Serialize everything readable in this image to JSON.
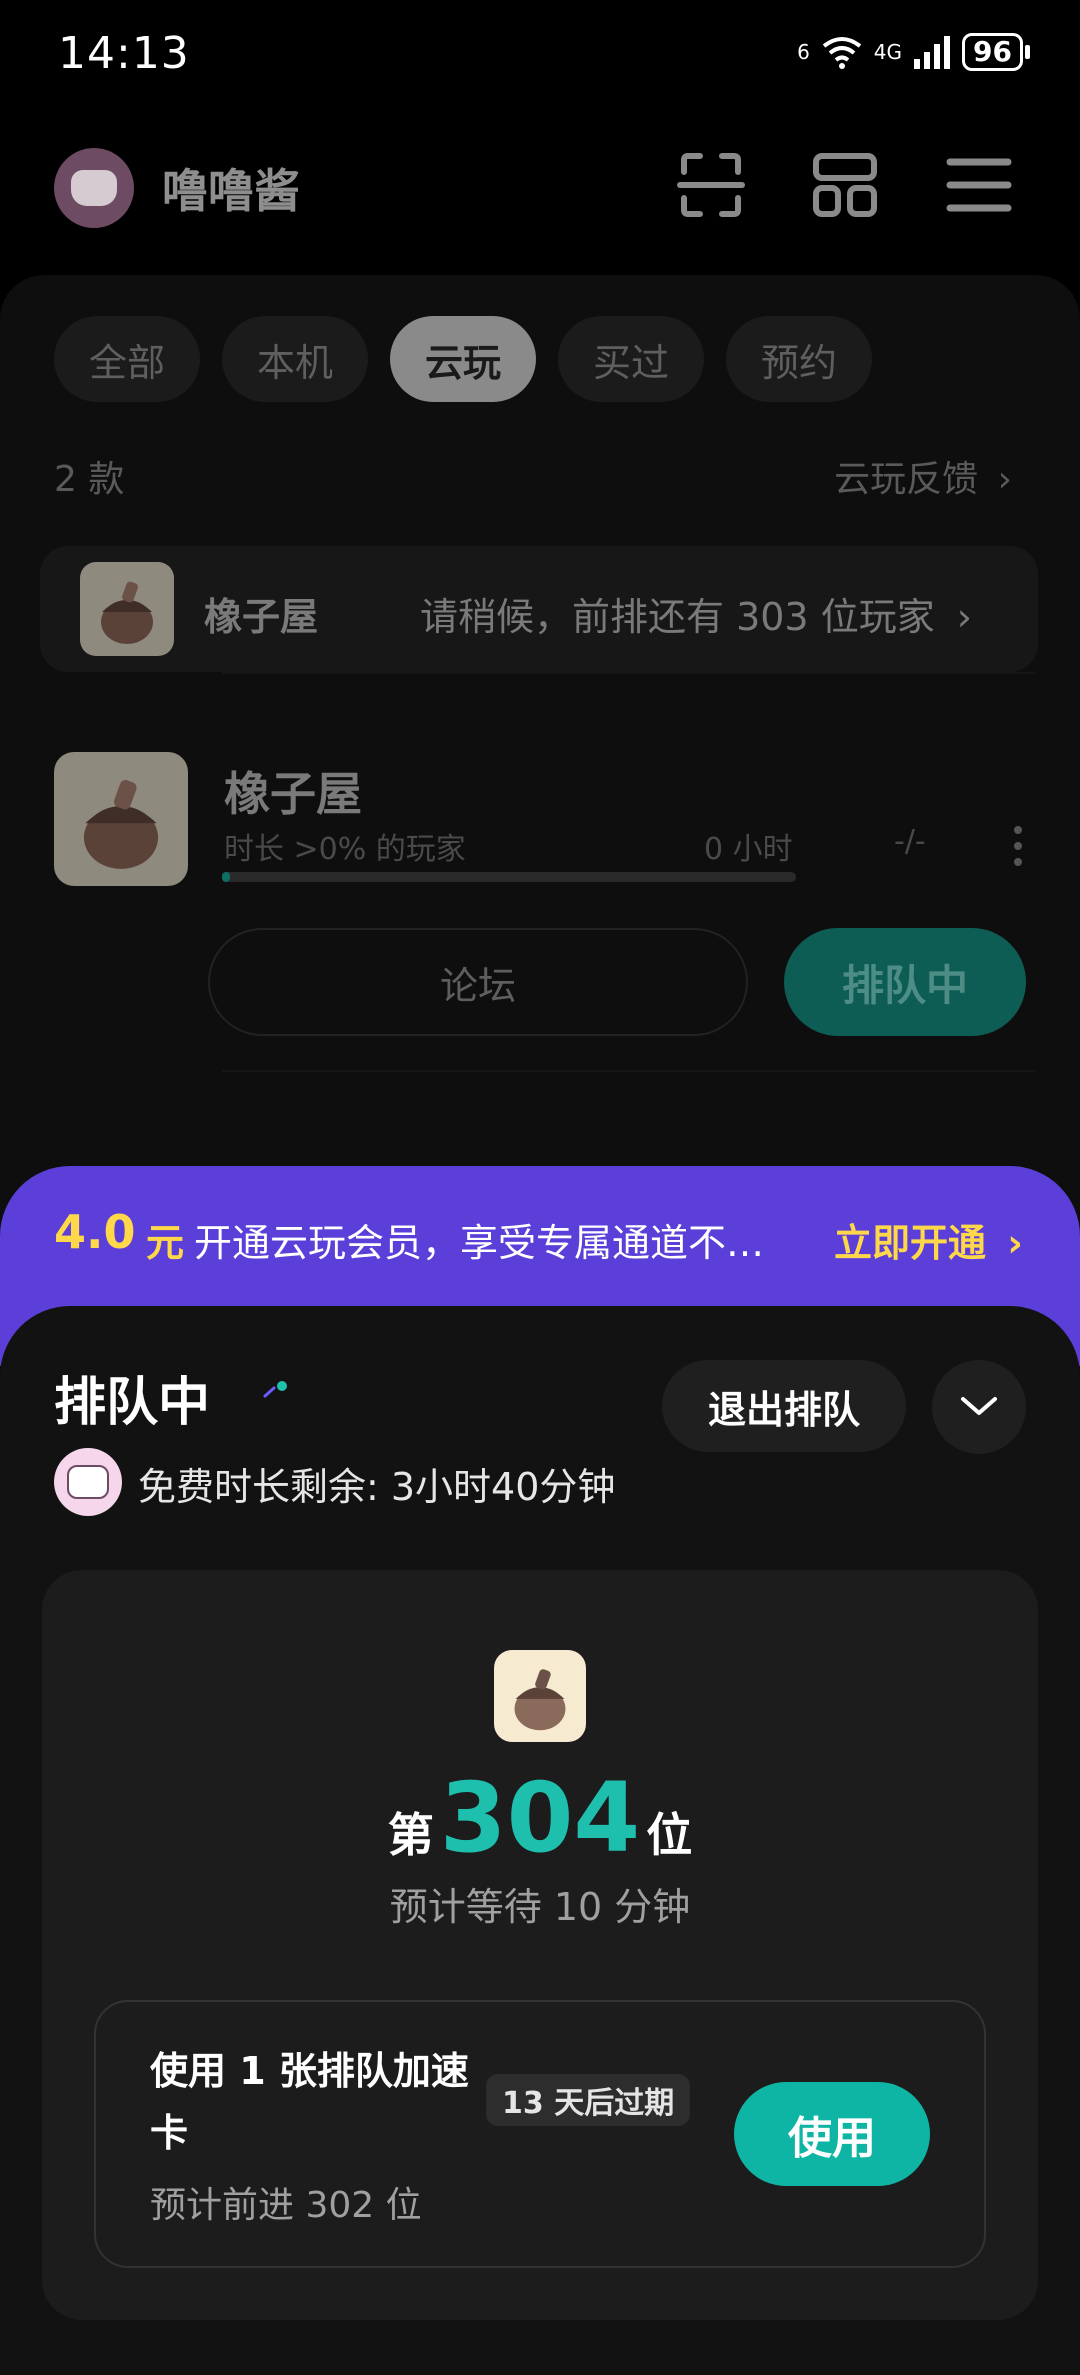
{
  "status_bar": {
    "time": "14:13",
    "signal_sim1": "6",
    "network_type": "4G",
    "battery": "96"
  },
  "header": {
    "username": "噜噜酱",
    "icons": [
      "scan-icon",
      "layout-grid-icon",
      "menu-icon"
    ]
  },
  "tabs": [
    {
      "label": "全部",
      "active": false
    },
    {
      "label": "本机",
      "active": false
    },
    {
      "label": "云玩",
      "active": true
    },
    {
      "label": "买过",
      "active": false
    },
    {
      "label": "预约",
      "active": false
    }
  ],
  "list_meta": {
    "count": "2 款",
    "feedback": "云玩反馈"
  },
  "queue_strip": {
    "game_name": "橡子屋",
    "message": "请稍候，前排还有 303 位玩家"
  },
  "game_card": {
    "name": "橡子屋",
    "subtitle": "时长 >0% 的玩家",
    "hours": "0 小时",
    "rating": "-/-",
    "progress": 0.01,
    "forum_label": "论坛",
    "queue_label": "排队中"
  },
  "promo": {
    "price": "4.0",
    "unit": "元",
    "text": "开通云玩会员，享受专属通道不…",
    "cta": "立即开通"
  },
  "queue_sheet": {
    "title": "排队中",
    "exit_label": "退出排队",
    "free_time": "免费时长剩余: 3小时40分钟",
    "rank_prefix": "第",
    "rank_number": "304",
    "rank_suffix": "位",
    "wait_text": "预计等待 10 分钟",
    "speed_card": {
      "title": "使用 1 张排队加速卡",
      "expire": "13 天后过期",
      "subtitle": "预计前进 302 位",
      "use_label": "使用"
    }
  },
  "colors": {
    "accent_teal": "#1fbfae",
    "promo_purple": "#5b3fd8",
    "promo_yellow": "#ffd84a"
  }
}
